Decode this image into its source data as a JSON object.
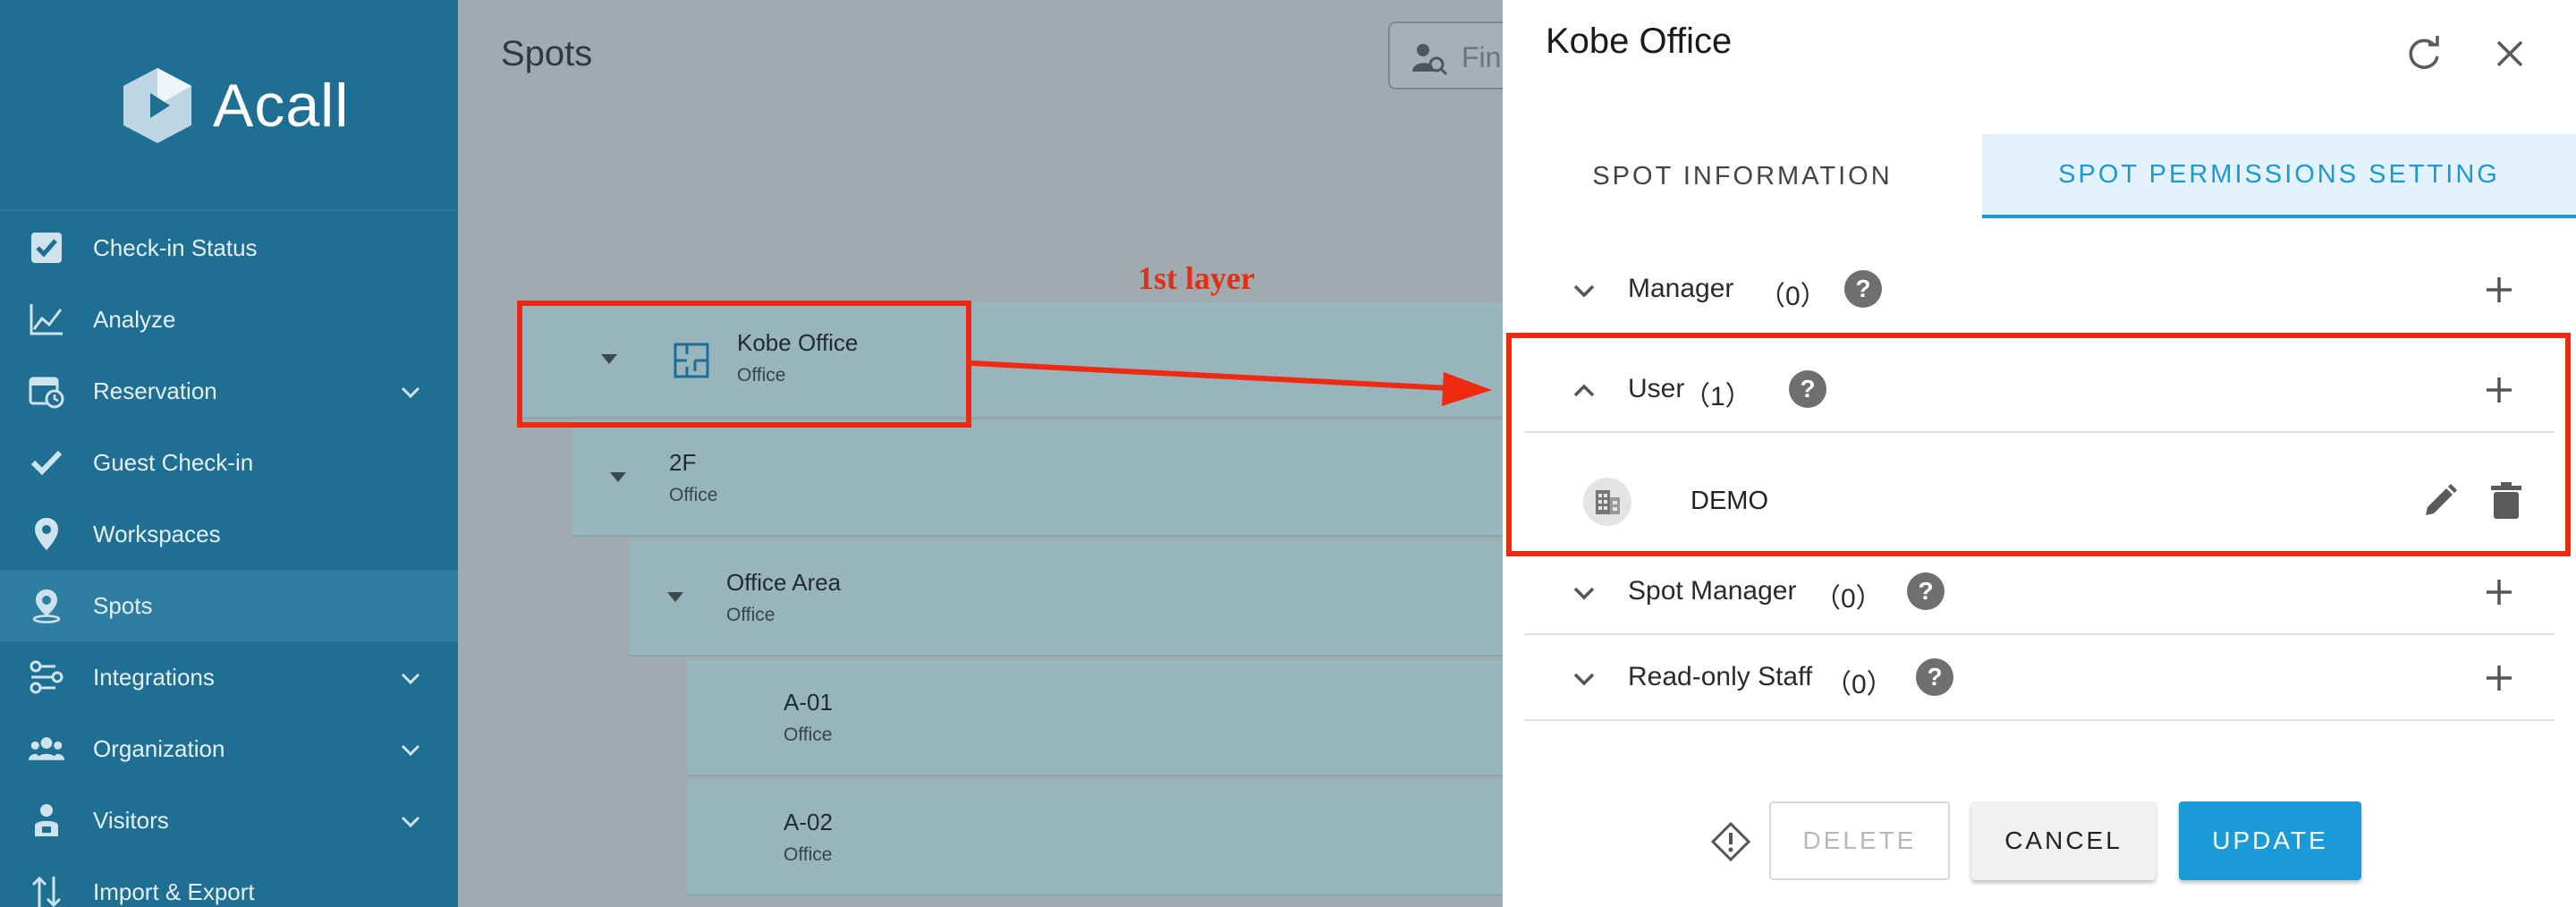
{
  "sidebar": {
    "brand": "Acall",
    "items": [
      {
        "label": "Check-in Status",
        "icon": "check-square-icon",
        "expandable": false
      },
      {
        "label": "Analyze",
        "icon": "line-chart-icon",
        "expandable": false
      },
      {
        "label": "Reservation",
        "icon": "calendar-clock-icon",
        "expandable": true
      },
      {
        "label": "Guest Check-in",
        "icon": "checkmark-icon",
        "expandable": false
      },
      {
        "label": "Workspaces",
        "icon": "map-pin-icon",
        "expandable": false
      },
      {
        "label": "Spots",
        "icon": "location-pin-icon",
        "expandable": false,
        "active": true
      },
      {
        "label": "Integrations",
        "icon": "integrations-icon",
        "expandable": true
      },
      {
        "label": "Organization",
        "icon": "people-icon",
        "expandable": true
      },
      {
        "label": "Visitors",
        "icon": "visitor-icon",
        "expandable": true
      },
      {
        "label": "Import & Export",
        "icon": "import-export-icon",
        "expandable": false
      }
    ]
  },
  "main": {
    "title": "Spots",
    "search_placeholder": "Fin",
    "annotation_label": "1st layer",
    "tree": [
      {
        "name": "Kobe Office",
        "type": "Office"
      },
      {
        "name": "2F",
        "type": "Office"
      },
      {
        "name": "Office Area",
        "type": "Office"
      },
      {
        "name": "A-01",
        "type": "Office"
      },
      {
        "name": "A-02",
        "type": "Office"
      }
    ]
  },
  "panel": {
    "title": "Kobe Office",
    "tabs": [
      "SPOT INFORMATION",
      "SPOT PERMISSIONS SETTING"
    ],
    "active_tab": 1,
    "sections": [
      {
        "label": "Manager",
        "count": "（0）",
        "expanded": false
      },
      {
        "label": "User",
        "count": "（1）",
        "expanded": true
      },
      {
        "label": "Spot Manager",
        "count": "（0）",
        "expanded": false
      },
      {
        "label": "Read-only Staff",
        "count": "（0）",
        "expanded": false
      }
    ],
    "user_members": [
      {
        "name": "DEMO",
        "icon": "building-icon"
      }
    ],
    "buttons": {
      "delete": "DELETE",
      "cancel": "CANCEL",
      "update": "UPDATE"
    }
  },
  "colors": {
    "sidebar": "#1f6e93",
    "accent": "#1a99d6",
    "annotation": "#f02a10"
  }
}
